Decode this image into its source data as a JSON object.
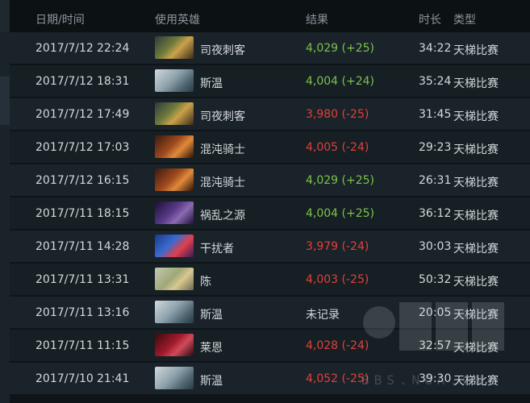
{
  "header": {
    "date_time": "日期/时间",
    "hero": "使用英雄",
    "result": "结果",
    "duration": "时长",
    "type": "类型"
  },
  "matches": [
    {
      "date": "2017/7/12",
      "time": "22:24",
      "hero": "司夜刺客",
      "result": "4,029 (+25)",
      "outcome": "win",
      "duration": "34:22",
      "type": "天梯比赛",
      "portrait": "nyx-assassin"
    },
    {
      "date": "2017/7/12",
      "time": "18:31",
      "hero": "斯温",
      "result": "4,004 (+24)",
      "outcome": "win",
      "duration": "35:24",
      "type": "天梯比赛",
      "portrait": "sven"
    },
    {
      "date": "2017/7/12",
      "time": "17:49",
      "hero": "司夜刺客",
      "result": "3,980 (-25)",
      "outcome": "loss",
      "duration": "31:45",
      "type": "天梯比赛",
      "portrait": "nyx-assassin"
    },
    {
      "date": "2017/7/12",
      "time": "17:03",
      "hero": "混沌骑士",
      "result": "4,005 (-24)",
      "outcome": "loss",
      "duration": "29:23",
      "type": "天梯比赛",
      "portrait": "chaos-knight"
    },
    {
      "date": "2017/7/12",
      "time": "16:15",
      "hero": "混沌骑士",
      "result": "4,029 (+25)",
      "outcome": "win",
      "duration": "26:31",
      "type": "天梯比赛",
      "portrait": "chaos-knight"
    },
    {
      "date": "2017/7/11",
      "time": "18:15",
      "hero": "祸乱之源",
      "result": "4,004 (+25)",
      "outcome": "win",
      "duration": "36:12",
      "type": "天梯比赛",
      "portrait": "bane"
    },
    {
      "date": "2017/7/11",
      "time": "14:28",
      "hero": "干扰者",
      "result": "3,979 (-24)",
      "outcome": "loss",
      "duration": "30:03",
      "type": "天梯比赛",
      "portrait": "disruptor"
    },
    {
      "date": "2017/7/11",
      "time": "13:31",
      "hero": "陈",
      "result": "4,003 (-25)",
      "outcome": "loss",
      "duration": "50:32",
      "type": "天梯比赛",
      "portrait": "chen"
    },
    {
      "date": "2017/7/11",
      "time": "13:16",
      "hero": "斯温",
      "result": "未记录",
      "outcome": "none",
      "duration": "20:05",
      "type": "天梯比赛",
      "portrait": "sven"
    },
    {
      "date": "2017/7/11",
      "time": "11:15",
      "hero": "莱恩",
      "result": "4,028 (-24)",
      "outcome": "loss",
      "duration": "32:57",
      "type": "天梯比赛",
      "portrait": "lion"
    },
    {
      "date": "2017/7/10",
      "time": "21:41",
      "hero": "斯温",
      "result": "4,052 (-25)",
      "outcome": "loss",
      "duration": "39:30",
      "type": "天梯比赛",
      "portrait": "sven"
    }
  ],
  "colors": {
    "win": "#7dc24b",
    "loss": "#e2403a"
  },
  "watermark": {
    "logo": "NGA",
    "url": "BBS.NGA.CN"
  }
}
